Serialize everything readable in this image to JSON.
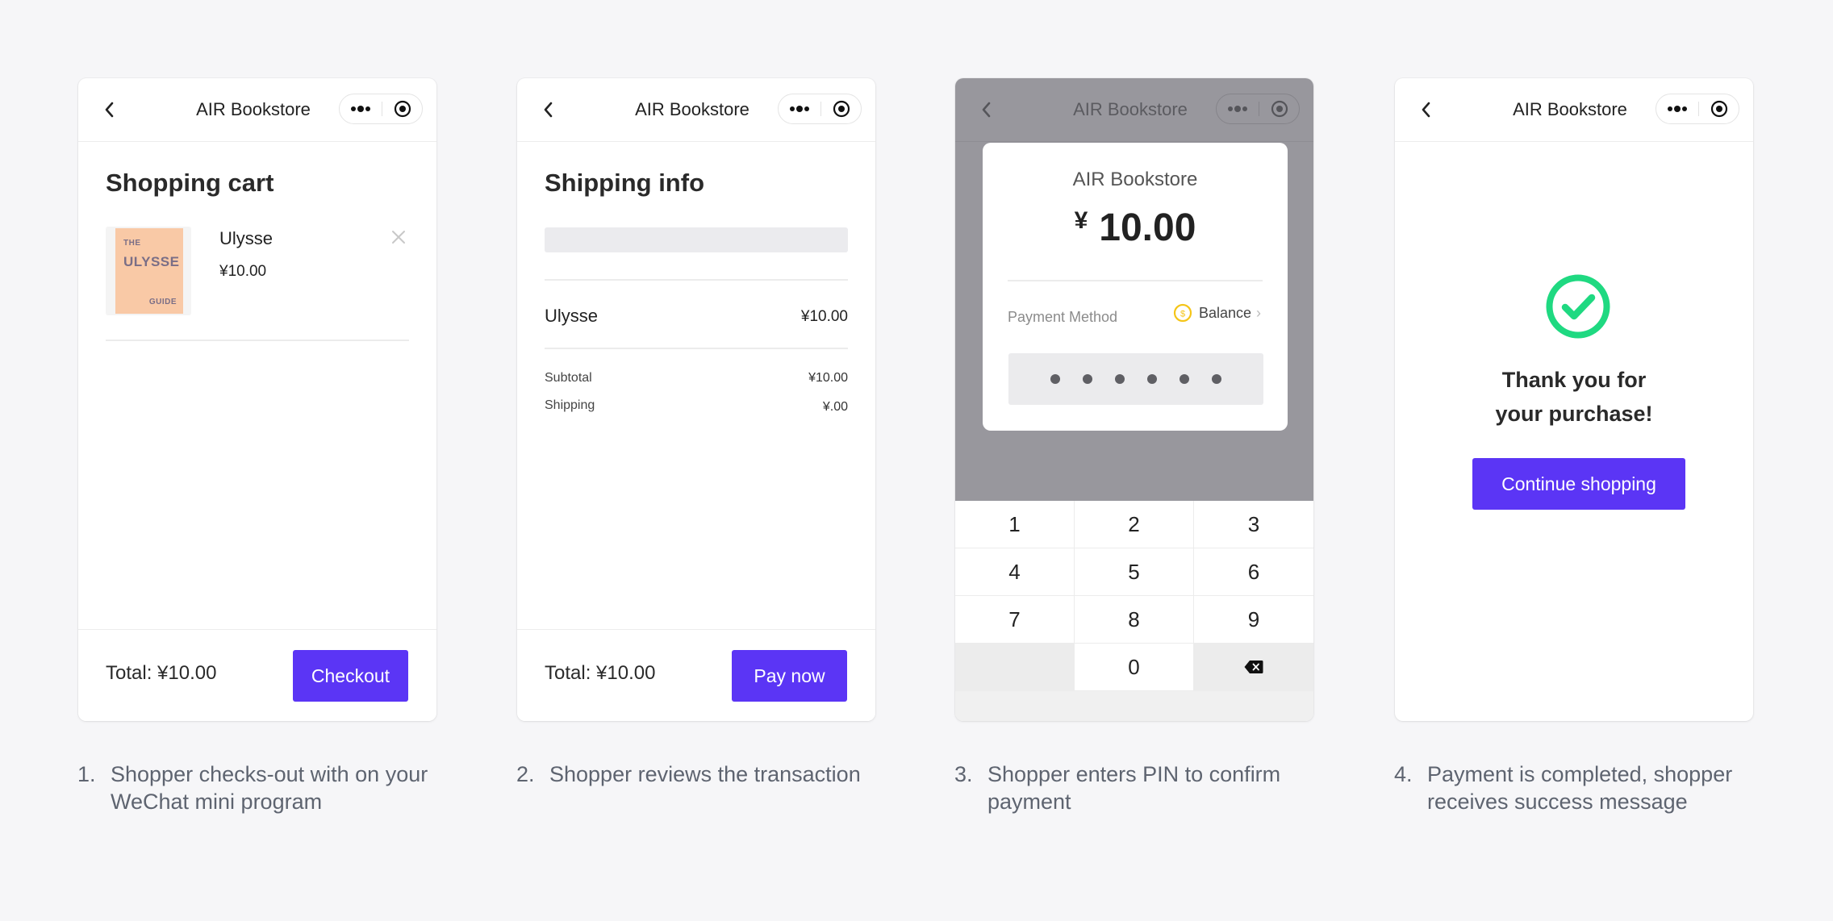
{
  "app": {
    "title": "AIR Bookstore"
  },
  "icons": {
    "back": "chevron-left-icon",
    "more": "more-dots-icon",
    "target": "target-icon",
    "close": "close-icon",
    "coin": "coin-icon",
    "backspace": "backspace-icon",
    "success": "check-circle-icon"
  },
  "colors": {
    "accent": "#5b35f5",
    "success": "#1fd981",
    "coin": "#f5c518",
    "background": "#f6f6f8"
  },
  "screen1": {
    "title": "Shopping cart",
    "item": {
      "name": "Ulysse",
      "price": "¥10.00",
      "cover": {
        "line1": "THE",
        "line2": "ULYSSE",
        "line3": "GUIDE"
      }
    },
    "total": "Total: ¥10.00",
    "button": "Checkout"
  },
  "screen2": {
    "title": "Shipping info",
    "item": {
      "name": "Ulysse",
      "price": "¥10.00"
    },
    "subtotal": {
      "label": "Subtotal",
      "value": "¥10.00"
    },
    "shipping": {
      "label": "Shipping",
      "value": "¥.00"
    },
    "total": "Total: ¥10.00",
    "button": "Pay now"
  },
  "screen3": {
    "merchant": "AIR Bookstore",
    "currency": "¥",
    "amount": "10.00",
    "payment_method_label": "Payment Method",
    "payment_method_value": "Balance",
    "pin_dots": 6,
    "keys": [
      "1",
      "2",
      "3",
      "4",
      "5",
      "6",
      "7",
      "8",
      "9",
      "0"
    ]
  },
  "screen4": {
    "thanks_line1": "Thank you for",
    "thanks_line2": "your purchase!",
    "button": "Continue shopping"
  },
  "captions": [
    {
      "num": "1.",
      "text": "Shopper checks-out with on your WeChat mini program"
    },
    {
      "num": "2.",
      "text": "Shopper reviews the transaction"
    },
    {
      "num": "3.",
      "text": "Shopper enters PIN to confirm payment"
    },
    {
      "num": "4.",
      "text": "Payment is completed, shopper receives success message"
    }
  ]
}
